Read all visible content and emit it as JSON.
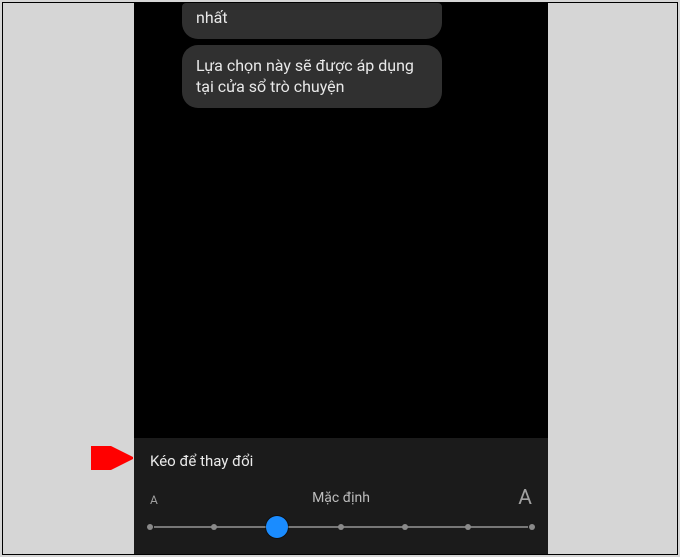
{
  "chat": {
    "bubbles": [
      {
        "text": "nhất"
      },
      {
        "text": "Lựa chọn này sẽ được áp dụng tại cửa sổ trò chuyện"
      }
    ]
  },
  "panel": {
    "title": "Kéo để thay đổi",
    "slider": {
      "small_label": "A",
      "large_label": "A",
      "center_label": "Mặc định",
      "ticks": 7,
      "value_index": 2,
      "thumb_color": "#1a8cff"
    }
  },
  "annotation": {
    "arrow_color": "#ff0000"
  }
}
